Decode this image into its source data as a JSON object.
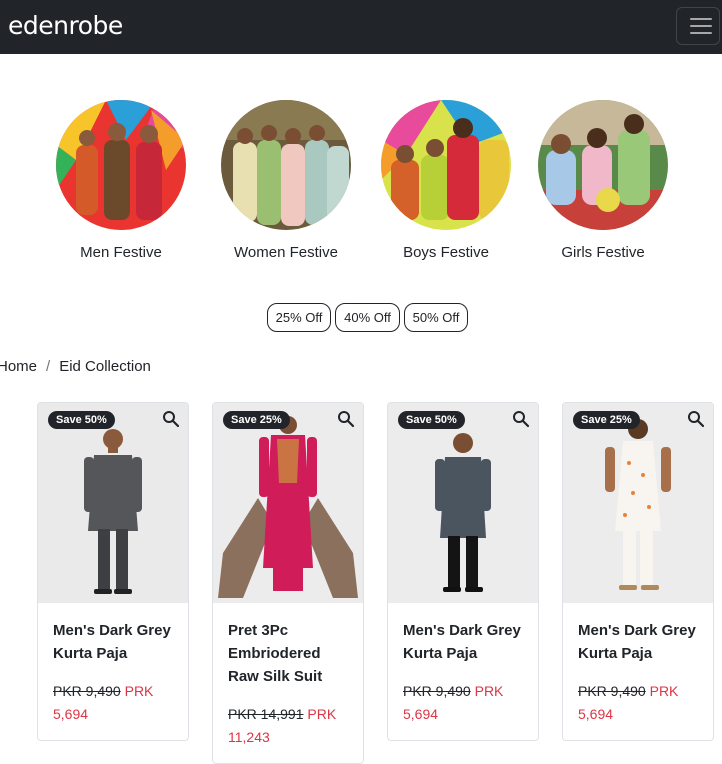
{
  "brand": {
    "logo_text": "edenrobe"
  },
  "categories": [
    {
      "label": "Men Festive"
    },
    {
      "label": "Women Festive"
    },
    {
      "label": "Boys Festive"
    },
    {
      "label": "Girls Festive"
    }
  ],
  "discounts": [
    "25% Off",
    "40% Off",
    "50% Off"
  ],
  "breadcrumb": {
    "home": "Home",
    "separator": "/",
    "current": "Eid Collection"
  },
  "products": [
    {
      "badge": "Save 50%",
      "name": "Men's Dark Grey Kurta Paja",
      "old_price": "PKR 9,490",
      "new_price": "PRK 5,694"
    },
    {
      "badge": "Save 25%",
      "name": "Pret 3Pc Embriodered Raw Silk Suit",
      "old_price": "PKR 14,991",
      "new_price": "PRK 11,243"
    },
    {
      "badge": "Save 50%",
      "name": "Men's Dark Grey Kurta Paja",
      "old_price": "PKR 9,490",
      "new_price": "PRK 5,694"
    },
    {
      "badge": "Save 25%",
      "name": "Men's Dark Grey Kurta Paja",
      "old_price": "PKR 9,490",
      "new_price": "PRK 5,694"
    }
  ],
  "colors": {
    "navbar": "#212529",
    "sale_price": "#dc3545",
    "badge": "#212529"
  },
  "icons": {
    "menu": "hamburger-icon",
    "zoom": "search-icon"
  }
}
